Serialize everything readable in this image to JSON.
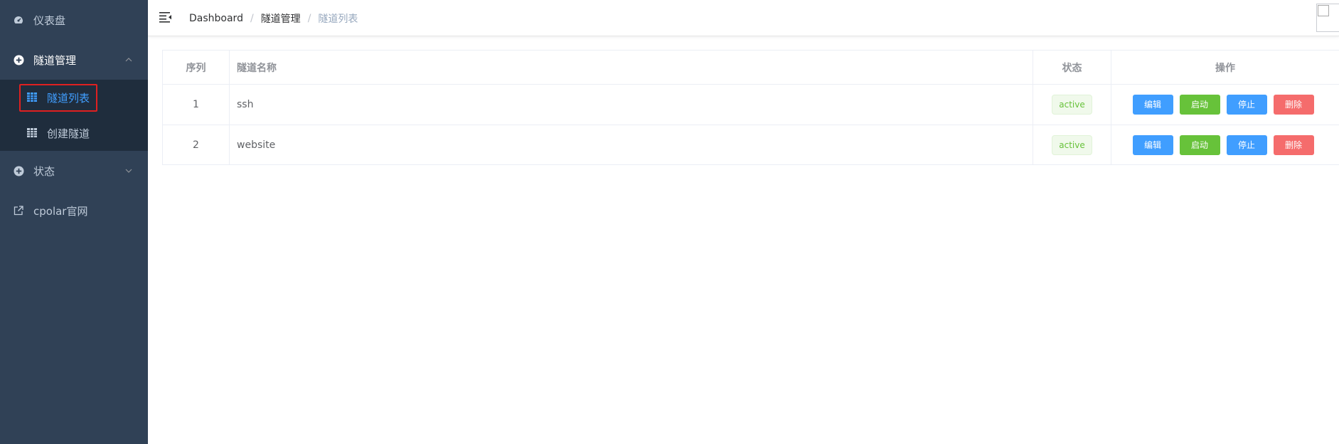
{
  "sidebar": {
    "items": [
      {
        "label": "仪表盘",
        "icon": "dashboard-icon"
      },
      {
        "label": "隧道管理",
        "icon": "plus-circle-icon",
        "expanded": true
      },
      {
        "label": "状态",
        "icon": "plus-circle-icon",
        "expanded": false
      },
      {
        "label": "cpolar官网",
        "icon": "external-link-icon"
      }
    ],
    "submenu": [
      {
        "label": "隧道列表",
        "icon": "table-icon",
        "active": true
      },
      {
        "label": "创建隧道",
        "icon": "table-icon",
        "active": false
      }
    ]
  },
  "breadcrumb": [
    "Dashboard",
    "隧道管理",
    "隧道列表"
  ],
  "breadcrumb_separator": "/",
  "table": {
    "columns": [
      "序列",
      "隧道名称",
      "状态",
      "操作"
    ],
    "rows": [
      {
        "index": "1",
        "name": "ssh",
        "status": "active"
      },
      {
        "index": "2",
        "name": "website",
        "status": "active"
      }
    ],
    "actions": [
      "编辑",
      "启动",
      "停止",
      "删除"
    ]
  },
  "colors": {
    "sidebar_bg": "#304156",
    "submenu_bg": "#1f2d3d",
    "active_text": "#409eff",
    "primary": "#409eff",
    "success": "#67c23a",
    "danger": "#f56c6c",
    "highlight_border": "#e02020"
  }
}
